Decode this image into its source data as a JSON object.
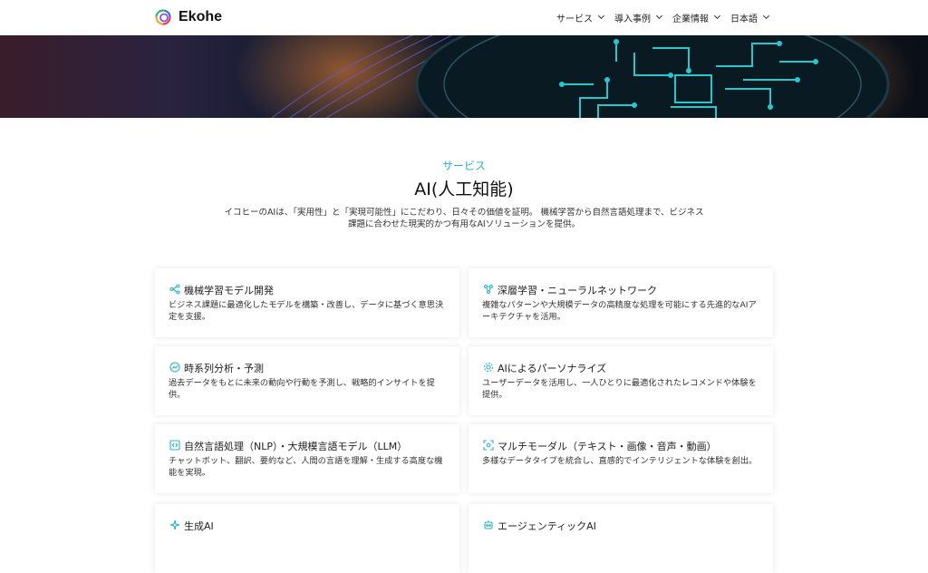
{
  "header": {
    "brand": "Ekohe",
    "nav": [
      {
        "label": "サービス"
      },
      {
        "label": "導入事例"
      },
      {
        "label": "企業情報"
      },
      {
        "label": "日本語"
      }
    ]
  },
  "section": {
    "eyebrow": "サービス",
    "title": "AI(人工知能)",
    "lead_line1": "イコヒーのAIは、「実用性」と「実現可能性」にこだわり、日々その価値を証明。 機械学習から自然言語処理まで、ビジネス",
    "lead_line2": "課題に合わせた現実的かつ有用なAIソリューションを提供。"
  },
  "cards": [
    {
      "title": "機械学習モデル開発",
      "desc": "ビジネス課題に最適化したモデルを構築・改善し、データに基づく意思決定を支援。",
      "icon": "network-nodes-icon"
    },
    {
      "title": "深層学習・ニューラルネットワーク",
      "desc": "複雑なパターンや大規模データの高精度な処理を可能にする先進的なAIアーキテクチャを活用。",
      "icon": "neural-network-icon"
    },
    {
      "title": "時系列分析・予測",
      "desc": "過去データをもとに未来の動向や行動を予測し、戦略的インサイトを提供。",
      "icon": "chart-circle-icon"
    },
    {
      "title": "AIによるパーソナライズ",
      "desc": "ユーザーデータを活用し、一人ひとりに最適化されたレコメンドや体験を提供。",
      "icon": "gear-icon"
    },
    {
      "title": "自然言語処理（NLP）・大規模言語モデル（LLM）",
      "desc": "チャットボット、翻訳、要約など、人間の言語を理解・生成する高度な機能を実現。",
      "icon": "code-brackets-icon"
    },
    {
      "title": "マルチモーダル（テキスト・画像・音声・動画）",
      "desc": "多様なデータタイプを統合し、直感的でインテリジェントな体験を創出。",
      "icon": "scan-frame-icon"
    },
    {
      "title": "生成AI",
      "desc": "",
      "icon": "sparkle-icon"
    },
    {
      "title": "エージェンティックAI",
      "desc": "",
      "icon": "agent-icon"
    }
  ],
  "colors": {
    "accent": "#2bb3c8",
    "text": "#222222"
  }
}
